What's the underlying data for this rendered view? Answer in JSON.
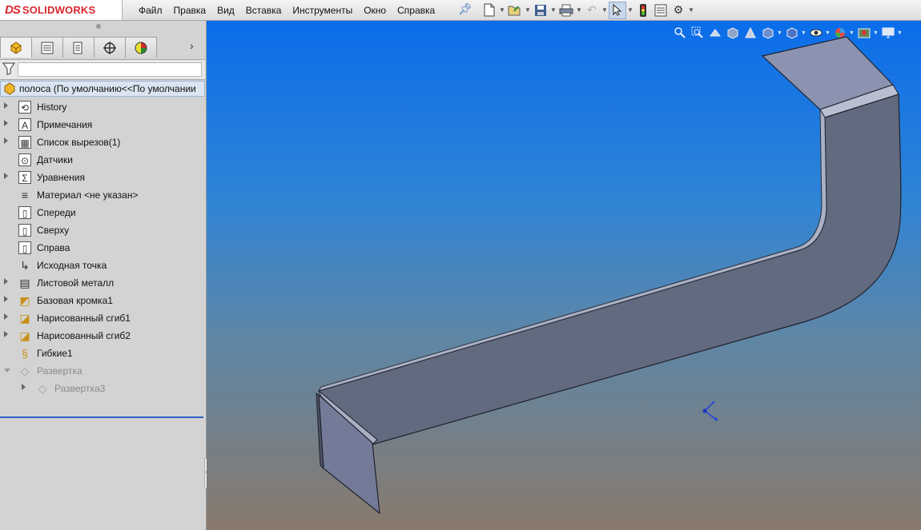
{
  "app": {
    "logo_ds": "DS",
    "logo_brand": "SOLIDWORKS"
  },
  "menu": [
    "Файл",
    "Правка",
    "Вид",
    "Вставка",
    "Инструменты",
    "Окно",
    "Справка"
  ],
  "toolbar": {
    "icons": [
      "new-document-icon",
      "open-icon",
      "save-icon",
      "print-icon",
      "undo-icon",
      "select-icon",
      "rebuild-icon",
      "file-properties-icon",
      "options-icon"
    ]
  },
  "feature_tree": {
    "tabs": [
      "feature-manager-icon",
      "property-manager-icon",
      "configuration-manager-icon",
      "dimxpert-icon",
      "display-manager-icon"
    ],
    "root": "полоса  (По умолчанию<<По умолчании",
    "items": [
      {
        "label": "History",
        "icon": "history-icon",
        "expandable": true
      },
      {
        "label": "Примечания",
        "icon": "annotations-icon",
        "expandable": true
      },
      {
        "label": "Список вырезов(1)",
        "icon": "cut-list-icon",
        "expandable": true
      },
      {
        "label": "Датчики",
        "icon": "sensors-icon",
        "expandable": false
      },
      {
        "label": "Уравнения",
        "icon": "equations-icon",
        "expandable": true
      },
      {
        "label": "Материал <не указан>",
        "icon": "material-icon",
        "expandable": false
      },
      {
        "label": "Спереди",
        "icon": "plane-icon",
        "expandable": false
      },
      {
        "label": "Сверху",
        "icon": "plane-icon",
        "expandable": false
      },
      {
        "label": "Справа",
        "icon": "plane-icon",
        "expandable": false
      },
      {
        "label": "Исходная точка",
        "icon": "origin-icon",
        "expandable": false
      },
      {
        "label": "Листовой металл",
        "icon": "sheet-metal-icon",
        "expandable": true
      },
      {
        "label": "Базовая кромка1",
        "icon": "base-flange-icon",
        "expandable": true
      },
      {
        "label": "Нарисованный сгиб1",
        "icon": "sketched-bend-icon",
        "expandable": true
      },
      {
        "label": "Нарисованный сгиб2",
        "icon": "sketched-bend-icon",
        "expandable": true
      },
      {
        "label": "Гибкие1",
        "icon": "flex-icon",
        "expandable": false
      },
      {
        "label": "Развертка",
        "icon": "flat-pattern-icon",
        "expandable": true,
        "suppressed": true
      },
      {
        "label": "Развертка3",
        "icon": "flat-pattern-icon",
        "expandable": true,
        "suppressed": true,
        "child": true
      }
    ]
  },
  "viewport": {
    "hud_icons": [
      "zoom-to-fit-icon",
      "zoom-area-icon",
      "previous-view-icon",
      "section-view-icon",
      "dynamic-annotation-icon",
      "view-orientation-icon",
      "display-style-icon",
      "hide-show-icon",
      "edit-appearance-icon",
      "apply-scene-icon",
      "view-settings-icon"
    ],
    "background_top": "#0a6dea",
    "background_bottom": "#897a6d",
    "part_face": "#6f7d97"
  }
}
